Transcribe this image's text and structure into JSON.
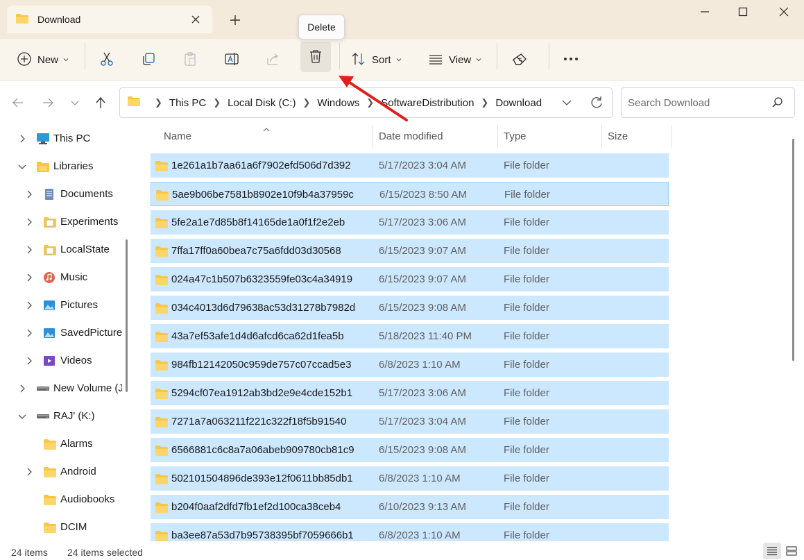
{
  "window": {
    "tab_title": "Download",
    "folder_icon": "folder-icon",
    "tooltip": "Delete"
  },
  "toolbar": {
    "new_label": "New",
    "sort_label": "Sort",
    "view_label": "View"
  },
  "breadcrumb": [
    "This PC",
    "Local Disk (C:)",
    "Windows",
    "SoftwareDistribution",
    "Download"
  ],
  "search": {
    "placeholder": "Search Download"
  },
  "sidebar": {
    "items": [
      {
        "label": "This PC",
        "icon": "computer-icon",
        "indent": 0,
        "expander": "collapsed"
      },
      {
        "label": "Libraries",
        "icon": "libraries-icon",
        "indent": 0,
        "expander": "expanded"
      },
      {
        "label": "Documents",
        "icon": "documents-icon",
        "indent": 1,
        "expander": "collapsed"
      },
      {
        "label": "Experiments",
        "icon": "library-folder-icon",
        "indent": 1,
        "expander": "collapsed"
      },
      {
        "label": "LocalState",
        "icon": "library-folder-icon",
        "indent": 1,
        "expander": "collapsed"
      },
      {
        "label": "Music",
        "icon": "music-icon",
        "indent": 1,
        "expander": "collapsed"
      },
      {
        "label": "Pictures",
        "icon": "pictures-icon",
        "indent": 1,
        "expander": "collapsed"
      },
      {
        "label": "SavedPictures",
        "icon": "pictures-icon",
        "indent": 1,
        "expander": "collapsed"
      },
      {
        "label": "Videos",
        "icon": "videos-icon",
        "indent": 1,
        "expander": "collapsed"
      },
      {
        "label": "New Volume (J:)",
        "icon": "drive-icon",
        "indent": 0,
        "expander": "collapsed"
      },
      {
        "label": "RAJ' (K:)",
        "icon": "drive-icon",
        "indent": 0,
        "expander": "expanded"
      },
      {
        "label": "Alarms",
        "icon": "folder-icon",
        "indent": 1,
        "expander": "none"
      },
      {
        "label": "Android",
        "icon": "folder-icon",
        "indent": 1,
        "expander": "collapsed"
      },
      {
        "label": "Audiobooks",
        "icon": "folder-icon",
        "indent": 1,
        "expander": "none"
      },
      {
        "label": "DCIM",
        "icon": "folder-icon",
        "indent": 1,
        "expander": "none"
      }
    ]
  },
  "columns": {
    "name": "Name",
    "date": "Date modified",
    "type": "Type",
    "size": "Size"
  },
  "files": [
    {
      "name": "1e261a1b7aa61a6f7902efd506d7d392",
      "date": "5/17/2023 3:04 AM",
      "type": "File folder"
    },
    {
      "name": "5ae9b06be7581b8902e10f9b4a37959c",
      "date": "6/15/2023 8:50 AM",
      "type": "File folder"
    },
    {
      "name": "5fe2a1e7d85b8f14165de1a0f1f2e2eb",
      "date": "5/17/2023 3:06 AM",
      "type": "File folder"
    },
    {
      "name": "7ffa17ff0a60bea7c75a6fdd03d30568",
      "date": "6/15/2023 9:07 AM",
      "type": "File folder"
    },
    {
      "name": "024a47c1b507b6323559fe03c4a34919",
      "date": "6/15/2023 9:07 AM",
      "type": "File folder"
    },
    {
      "name": "034c4013d6d79638ac53d31278b7982d",
      "date": "6/15/2023 9:08 AM",
      "type": "File folder"
    },
    {
      "name": "43a7ef53afe1d4d6afcd6ca62d1fea5b",
      "date": "5/18/2023 11:40 PM",
      "type": "File folder"
    },
    {
      "name": "984fb12142050c959de757c07ccad5e3",
      "date": "6/8/2023 1:10 AM",
      "type": "File folder"
    },
    {
      "name": "5294cf07ea1912ab3bd2e9e4cde152b1",
      "date": "5/17/2023 3:06 AM",
      "type": "File folder"
    },
    {
      "name": "7271a7a063211f221c322f18f5b91540",
      "date": "5/17/2023 3:04 AM",
      "type": "File folder"
    },
    {
      "name": "6566881c6c8a7a06abeb909780cb81c9",
      "date": "6/15/2023 9:08 AM",
      "type": "File folder"
    },
    {
      "name": "502101504896de393e12f0611bb85db1",
      "date": "6/8/2023 1:10 AM",
      "type": "File folder"
    },
    {
      "name": "b204f0aaf2dfd7fb1ef2d100ca38ceb4",
      "date": "6/10/2023 9:13 AM",
      "type": "File folder"
    },
    {
      "name": "ba3ee87a53d7b95738395bf7059666b1",
      "date": "6/8/2023 1:10 AM",
      "type": "File folder"
    }
  ],
  "status": {
    "item_count": "24 items",
    "selected": "24 items selected"
  },
  "colors": {
    "selection": "#cce8ff",
    "focus_border": "#99d1ff",
    "titlebar": "#f3eadb",
    "toolbar": "#faf5ec",
    "folder": "#f8c642",
    "arrow": "#e0201c"
  }
}
